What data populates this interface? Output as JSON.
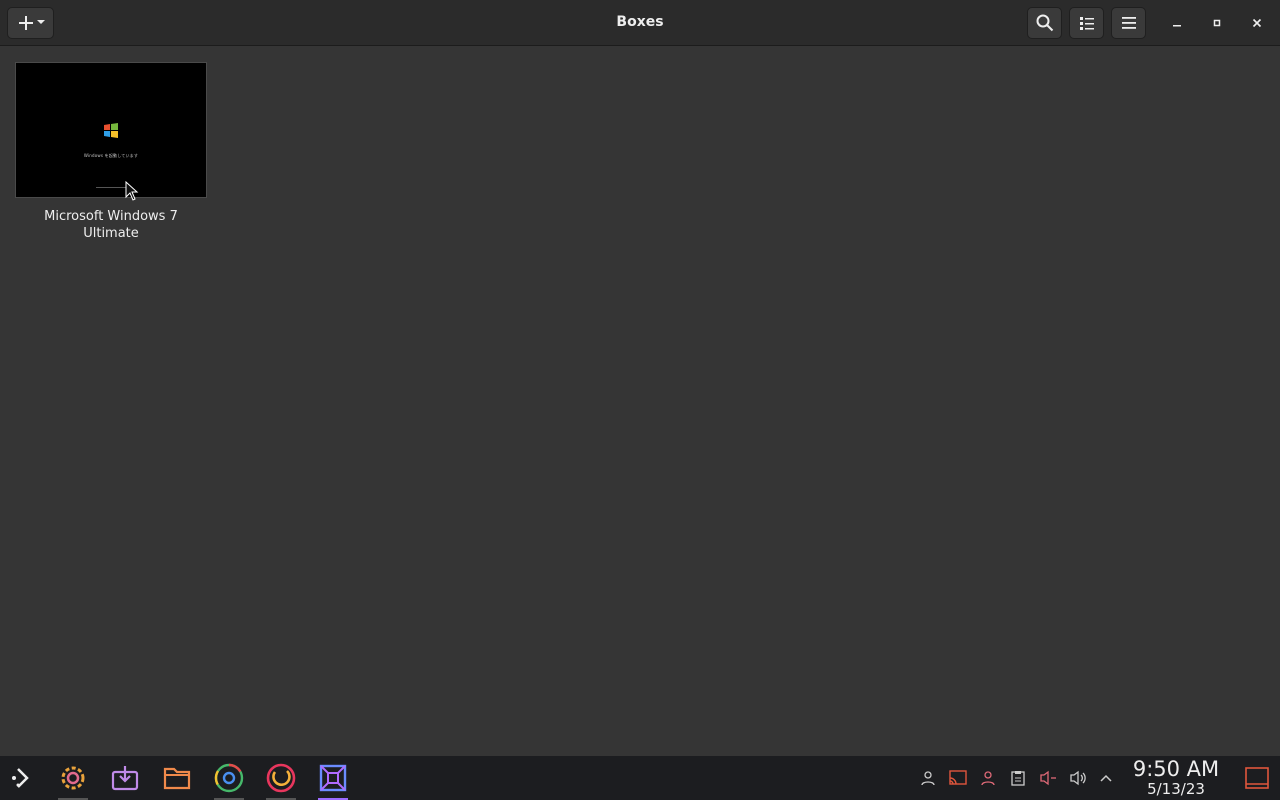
{
  "header": {
    "title": "Boxes",
    "new_icon": "plus-icon",
    "search_icon": "search-icon",
    "view_icon": "list-view-icon",
    "menu_icon": "hamburger-menu-icon"
  },
  "boxes": [
    {
      "name": "Microsoft Windows 7 Ultimate",
      "name_line1": "Microsoft Windows 7",
      "name_line2": "Ultimate",
      "thumbnail_text": "Windows を起動しています"
    }
  ],
  "taskbar": {
    "apps": [
      {
        "name": "application-launcher",
        "icon": "steam-deck-launcher-icon"
      },
      {
        "name": "settings",
        "icon": "settings-gear-icon"
      },
      {
        "name": "discover",
        "icon": "software-center-icon"
      },
      {
        "name": "files",
        "icon": "folder-icon"
      },
      {
        "name": "chrome",
        "icon": "chrome-icon"
      },
      {
        "name": "firefox",
        "icon": "firefox-icon"
      },
      {
        "name": "boxes",
        "icon": "boxes-icon"
      }
    ],
    "tray_icons": [
      "user-icon",
      "cast-icon",
      "person-icon",
      "clipboard-icon",
      "microphone-muted-icon",
      "volume-icon",
      "expand-arrow-icon"
    ],
    "time": "9:50 AM",
    "date": "5/13/23"
  },
  "colors": {
    "background": "#353535",
    "headerbar": "#2b2b2b",
    "taskbar": "#1c1d20",
    "accent": "#9b6bff",
    "tray_accent": "#e0563c"
  }
}
